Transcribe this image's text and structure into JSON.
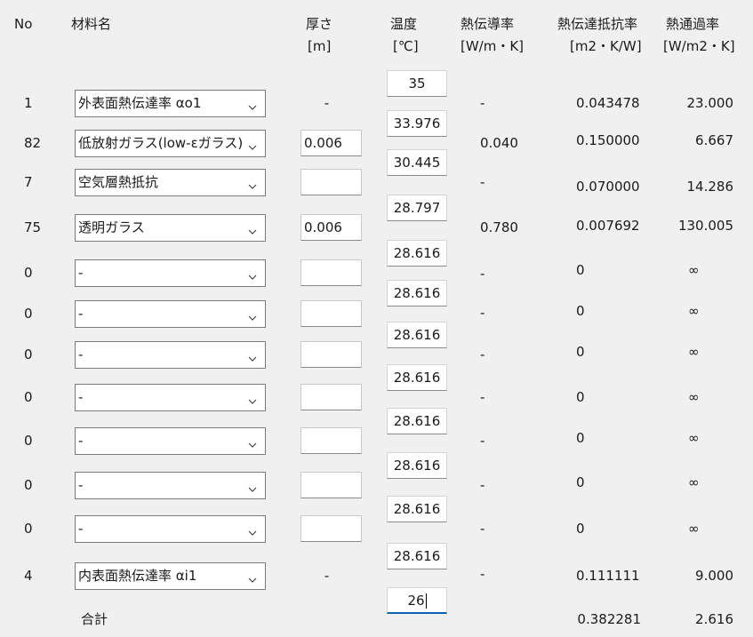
{
  "header": {
    "no": "No",
    "material": "材料名",
    "thickness": "厚さ",
    "thickness_unit": "[m]",
    "temp": "温度",
    "temp_unit": "[℃]",
    "conductivity": "熱伝導率",
    "conductivity_unit": "[W/m・K]",
    "resistance": "熱伝達抵抗率",
    "resistance_unit": "[m2・K/W]",
    "transmittance": "熱通過率",
    "transmittance_unit": "[W/m2・K]"
  },
  "rows": [
    {
      "no": "1",
      "material": "外表面熱伝達率 αo1",
      "thickness": "-",
      "thickness_input": false,
      "conductivity": "-",
      "resistance": "0.043478",
      "transmittance": "23.000"
    },
    {
      "no": "82",
      "material": "低放射ガラス(low-εガラス)",
      "thickness": "0.006",
      "thickness_input": true,
      "conductivity": "0.040",
      "resistance": "0.150000",
      "transmittance": "6.667"
    },
    {
      "no": "7",
      "material": "空気層熱抵抗",
      "thickness": "",
      "thickness_input": true,
      "conductivity": "-",
      "resistance": "0.070000",
      "transmittance": "14.286"
    },
    {
      "no": "75",
      "material": "透明ガラス",
      "thickness": "0.006",
      "thickness_input": true,
      "conductivity": "0.780",
      "resistance": "0.007692",
      "transmittance": "130.005"
    },
    {
      "no": "0",
      "material": "-",
      "thickness": "",
      "thickness_input": true,
      "conductivity": "-",
      "resistance": "0",
      "transmittance": "∞"
    },
    {
      "no": "0",
      "material": "-",
      "thickness": "",
      "thickness_input": true,
      "conductivity": "-",
      "resistance": "0",
      "transmittance": "∞"
    },
    {
      "no": "0",
      "material": "-",
      "thickness": "",
      "thickness_input": true,
      "conductivity": "-",
      "resistance": "0",
      "transmittance": "∞"
    },
    {
      "no": "0",
      "material": "-",
      "thickness": "",
      "thickness_input": true,
      "conductivity": "-",
      "resistance": "0",
      "transmittance": "∞"
    },
    {
      "no": "0",
      "material": "-",
      "thickness": "",
      "thickness_input": true,
      "conductivity": "-",
      "resistance": "0",
      "transmittance": "∞"
    },
    {
      "no": "0",
      "material": "-",
      "thickness": "",
      "thickness_input": true,
      "conductivity": "-",
      "resistance": "0",
      "transmittance": "∞"
    },
    {
      "no": "0",
      "material": "-",
      "thickness": "",
      "thickness_input": true,
      "conductivity": "-",
      "resistance": "0",
      "transmittance": "∞"
    },
    {
      "no": "4",
      "material": "内表面熱伝達率 αi1",
      "thickness": "-",
      "thickness_input": false,
      "conductivity": "-",
      "resistance": "0.111111",
      "transmittance": "9.000"
    }
  ],
  "temperatures": [
    "35",
    "33.976",
    "30.445",
    "28.797",
    "28.616",
    "28.616",
    "28.616",
    "28.616",
    "28.616",
    "28.616",
    "28.616",
    "28.616",
    "26"
  ],
  "total": {
    "label": "合計",
    "resistance": "0.382281",
    "transmittance": "2.616"
  }
}
